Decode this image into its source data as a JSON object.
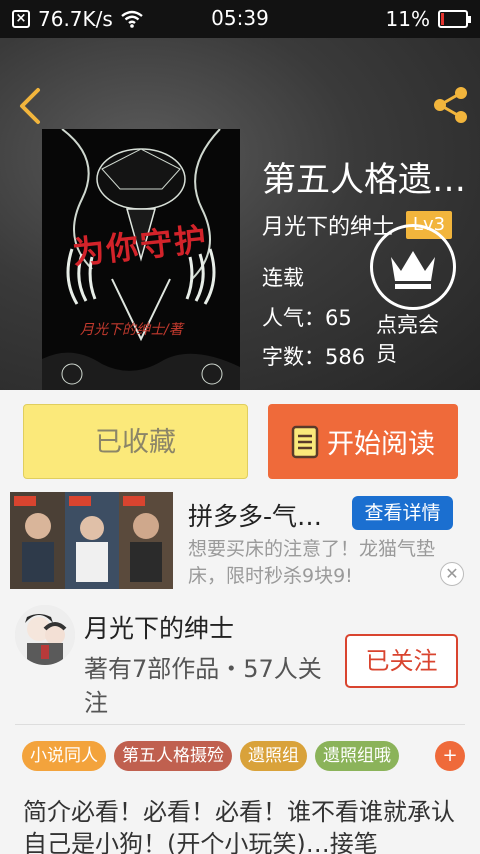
{
  "status_bar": {
    "speed": "76.7K/s",
    "time": "05:39",
    "battery": "11%",
    "battery_level": 0.11
  },
  "book": {
    "title": "第五人格遗…",
    "author": "月光下的绅士",
    "level": "Lv3",
    "status": "连载",
    "popularity": "人气：65",
    "word_count": "字数：586",
    "cover_text": "为你守护",
    "cover_subtitle": "月光下的绅士/著"
  },
  "vip": {
    "label": "点亮会员"
  },
  "actions": {
    "collect_label": "已收藏",
    "read_label": "开始阅读"
  },
  "ad": {
    "title": "拼多多-气…",
    "detail_label": "查看详情",
    "description": "想要买床的注意了！龙猫气垫床，限时秒杀9块9!",
    "close": "✕"
  },
  "author_block": {
    "name": "月光下的绅士",
    "stats": "著有7部作品・57人关注",
    "follow_label": "已关注"
  },
  "tags": [
    {
      "label": "小说同人",
      "color": "#f3a33c"
    },
    {
      "label": "第五人格摄殓",
      "color": "#c0604f"
    },
    {
      "label": "遗照组",
      "color": "#d9a23a"
    },
    {
      "label": "遗照组哦",
      "color": "#8bb35a"
    }
  ],
  "tag_more": "+",
  "intro": "简介必看！必看！必看！谁不看谁就承认自己是小狗！(开个小玩笑)…接笔",
  "colors": {
    "accent_orange": "#ef6a3a",
    "collect_yellow": "#fbe97a",
    "badge_gold": "#f2b53c",
    "follow_red": "#d9442f",
    "ad_blue": "#1b6fd0"
  }
}
